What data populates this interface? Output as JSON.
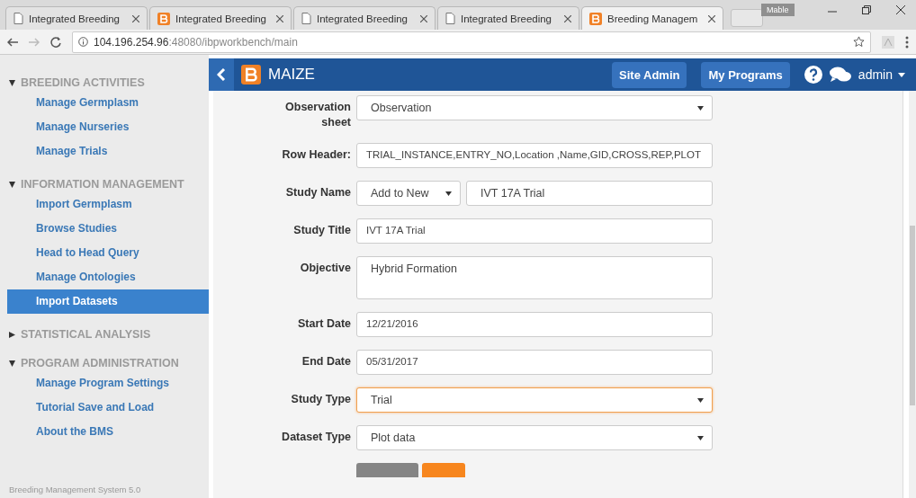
{
  "browser": {
    "tabs": [
      {
        "title": "Integrated Breeding",
        "kind": "page",
        "selected": false
      },
      {
        "title": "Integrated Breeding",
        "kind": "logo",
        "selected": false
      },
      {
        "title": "Integrated Breeding",
        "kind": "page",
        "selected": false
      },
      {
        "title": "Integrated Breeding",
        "kind": "page",
        "selected": false
      },
      {
        "title": "Breeding Managem",
        "kind": "logo",
        "selected": true
      }
    ],
    "user": "Mable",
    "url_host": "104.196.254.96",
    "url_rest": ":48080/ibpworkbench/main"
  },
  "sidebar": {
    "sections": [
      {
        "title": "BREEDING ACTIVITIES",
        "expanded": true,
        "items": [
          {
            "label": "Manage Germplasm",
            "selected": false
          },
          {
            "label": "Manage Nurseries",
            "selected": false
          },
          {
            "label": "Manage Trials",
            "selected": false
          }
        ]
      },
      {
        "title": "INFORMATION MANAGEMENT",
        "expanded": true,
        "items": [
          {
            "label": "Import Germplasm",
            "selected": false
          },
          {
            "label": "Browse Studies",
            "selected": false
          },
          {
            "label": "Head to Head Query",
            "selected": false
          },
          {
            "label": "Manage Ontologies",
            "selected": false
          },
          {
            "label": "Import Datasets",
            "selected": true
          }
        ]
      },
      {
        "title": "STATISTICAL ANALYSIS",
        "expanded": false
      },
      {
        "title": "PROGRAM ADMINISTRATION",
        "expanded": true,
        "items": [
          {
            "label": "Manage Program Settings",
            "selected": false
          },
          {
            "label": "Tutorial Save and Load",
            "selected": false
          },
          {
            "label": "About the BMS",
            "selected": false
          }
        ]
      }
    ],
    "footer": "Breeding Management System 5.0"
  },
  "header": {
    "crop": "MAIZE",
    "buttons": [
      "Site Admin",
      "My Programs"
    ],
    "user": "admin"
  },
  "form": {
    "fields": [
      {
        "label": "Observation sheet",
        "kind": "select",
        "value": "Observation",
        "focused": false
      },
      {
        "label": "Row Header:",
        "kind": "input",
        "value": "TRIAL_INSTANCE,ENTRY_NO,Location ,Name,GID,CROSS,REP,PLOT",
        "focused": false
      },
      {
        "label": "Study Name",
        "kind": "combo",
        "option": "Add to New",
        "value": "IVT 17A Trial",
        "focused": false
      },
      {
        "label": "Study Title",
        "kind": "input",
        "value": "IVT 17A Trial",
        "focused": false
      },
      {
        "label": "Objective",
        "kind": "textarea",
        "value": "Hybrid Formation",
        "focused": false
      },
      {
        "label": "Start Date",
        "kind": "input",
        "value": "12/21/2016",
        "focused": false
      },
      {
        "label": "End Date",
        "kind": "input",
        "value": "05/31/2017",
        "focused": false
      },
      {
        "label": "Study Type",
        "kind": "select",
        "value": "Trial",
        "focused": true
      },
      {
        "label": "Dataset Type",
        "kind": "select",
        "value": "Plot data",
        "focused": false
      }
    ],
    "actions": [
      {
        "kind": "secondary"
      },
      {
        "kind": "primary"
      }
    ]
  }
}
